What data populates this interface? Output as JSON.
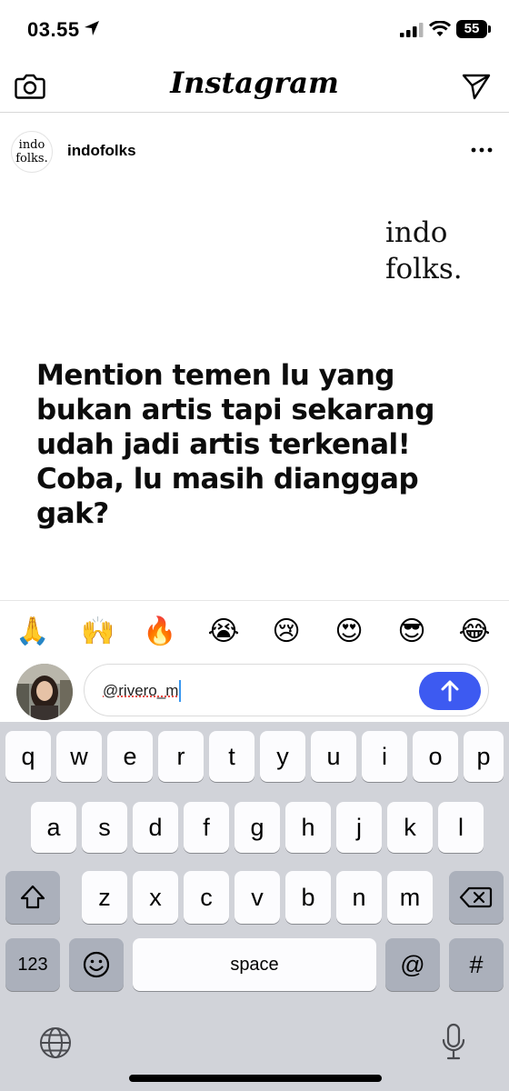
{
  "status_bar": {
    "time": "03.55",
    "battery": "55"
  },
  "header": {
    "app_title": "Instagram"
  },
  "post": {
    "username": "indofolks",
    "avatar_text": "indo\nfolks.",
    "brand_mark": "indo\nfolks.",
    "headline": "Mention temen lu yang bukan artis tapi sekarang udah jadi artis terkenal! Coba, lu masih dianggap gak?"
  },
  "emoji_bar": [
    "🙏",
    "🙌",
    "🔥",
    "😭",
    "😢",
    "😍",
    "😎",
    "😂"
  ],
  "composer": {
    "comment_value": "@rivero_m"
  },
  "keyboard": {
    "row1": [
      "q",
      "w",
      "e",
      "r",
      "t",
      "y",
      "u",
      "i",
      "o",
      "p"
    ],
    "row2": [
      "a",
      "s",
      "d",
      "f",
      "g",
      "h",
      "j",
      "k",
      "l"
    ],
    "row3": [
      "z",
      "x",
      "c",
      "v",
      "b",
      "n",
      "m"
    ],
    "numbers_label": "123",
    "space_label": "space",
    "at_label": "@",
    "hash_label": "#"
  },
  "icons": {
    "camera": "camera-icon",
    "send": "paper-plane-icon",
    "more": "ellipsis-icon",
    "submit": "arrow-up-icon",
    "shift": "shift-icon",
    "delete": "backspace-icon",
    "emoji": "emoji-icon",
    "globe": "globe-icon",
    "mic": "microphone-icon"
  }
}
